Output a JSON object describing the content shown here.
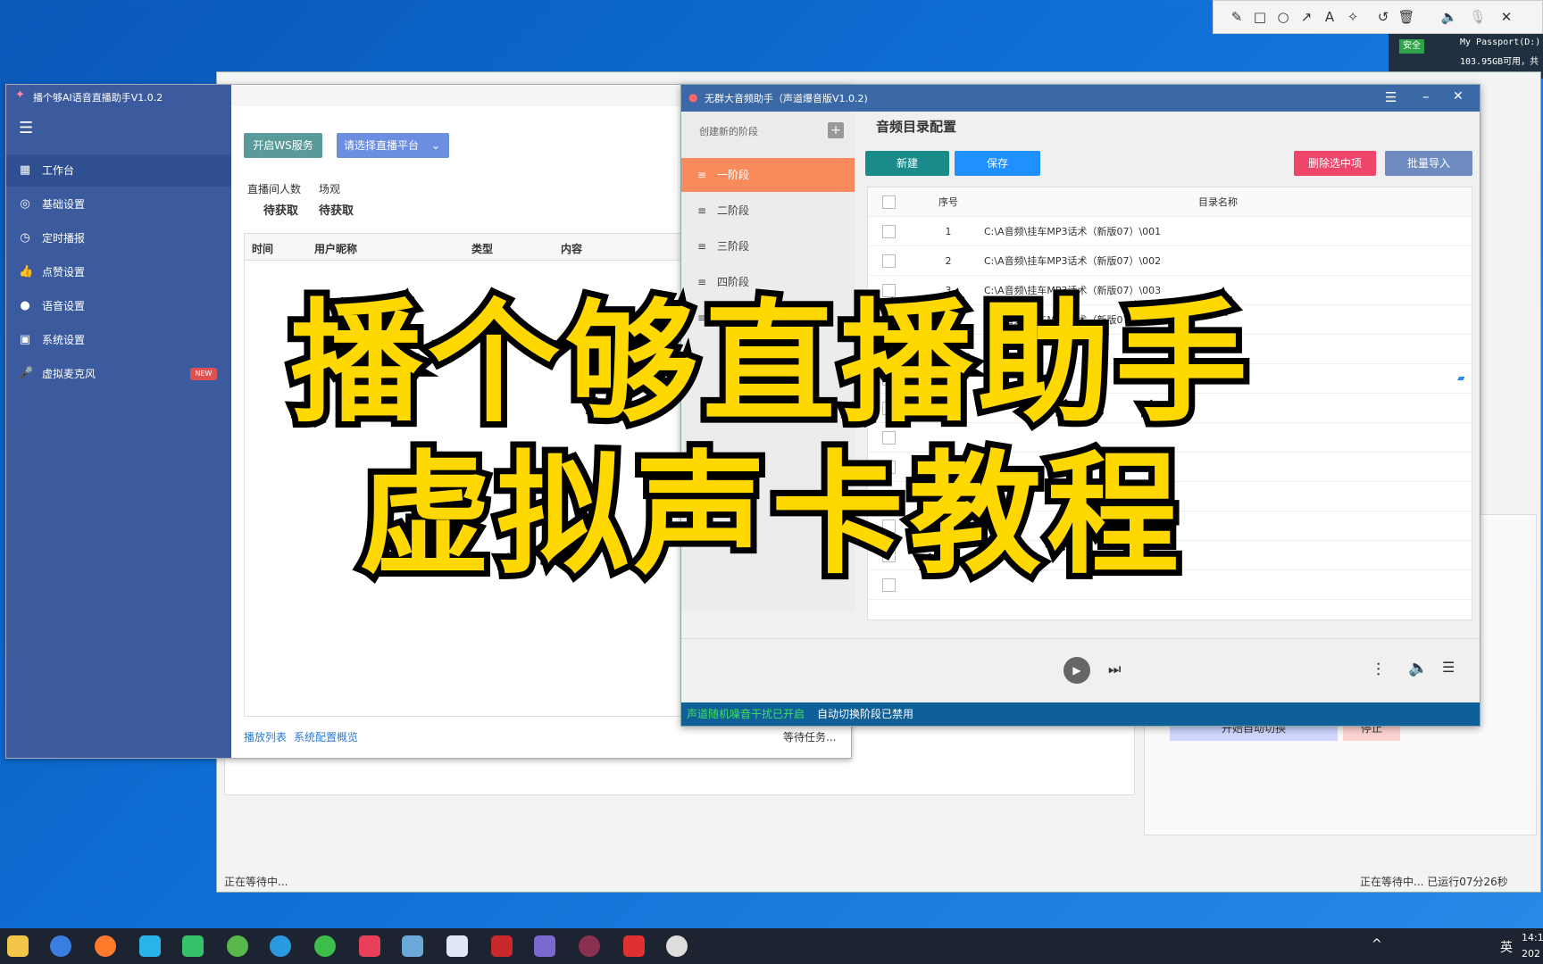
{
  "annotation_toolbar": {
    "icons": [
      "pencil-icon",
      "rectangle-icon",
      "circle-icon",
      "arrow-icon",
      "text-icon",
      "magic-icon",
      "undo-icon",
      "trash-icon",
      "volume-icon",
      "mute-icon",
      "close-icon"
    ]
  },
  "drive": {
    "badge": "安全",
    "name": "My Passport(D:)",
    "free": "103.95GB可用，共"
  },
  "back_window": {
    "status_left": "正在等待中...",
    "status_right": "正在等待中...  已运行07分26秒",
    "start_switch": "开始自动切换",
    "stop": "停止"
  },
  "main_app": {
    "title": "播个够AI语音直播助手V1.0.2",
    "nav": [
      {
        "label": "工作台",
        "icon": "dashboard-icon"
      },
      {
        "label": "基础设置",
        "icon": "settings-circle-icon"
      },
      {
        "label": "定时播报",
        "icon": "timer-icon"
      },
      {
        "label": "点赞设置",
        "icon": "thumbs-up-icon"
      },
      {
        "label": "语音设置",
        "icon": "voice-icon"
      },
      {
        "label": "系统设置",
        "icon": "grid-icon"
      },
      {
        "label": "虚拟麦克风",
        "icon": "mic-icon",
        "badge": "NEW"
      }
    ],
    "ws_button": "开启WS服务",
    "platform_select": "请选择直播平台",
    "stats": {
      "viewers_label": "直播间人数",
      "viewers_value": "待获取",
      "scene_label": "场观",
      "scene_value": "待获取"
    },
    "columns": [
      "时间",
      "用户昵称",
      "类型",
      "内容"
    ],
    "footer_links": [
      "播放列表",
      "系统配置概览"
    ],
    "footer_status": "等待任务..."
  },
  "audio_window": {
    "title": "无群大音频助手（声道爆音版V1.0.2)",
    "create_stage": "创建新的阶段",
    "stages": [
      "一阶段",
      "二阶段",
      "三阶段",
      "四阶段",
      "五阶段"
    ],
    "heading": "音频目录配置",
    "buttons": {
      "new": "新建",
      "save": "保存",
      "delete": "删除选中项",
      "import": "批量导入"
    },
    "columns": {
      "seq": "序号",
      "name": "目录名称"
    },
    "rows": [
      {
        "seq": "1",
        "dir": "C:\\A音频\\挂车MP3话术（新版07）\\001"
      },
      {
        "seq": "2",
        "dir": "C:\\A音频\\挂车MP3话术（新版07）\\002"
      },
      {
        "seq": "3",
        "dir": "C:\\A音频\\挂车MP3话术（新版07）\\003"
      },
      {
        "seq": "4",
        "dir": "C:\\A音频\\挂车MP3话术（新版07）\\004"
      }
    ],
    "status_green": "声道随机噪音干扰已开启",
    "status_white": "自动切换阶段已禁用"
  },
  "overlay": {
    "line1": "播个够直播助手",
    "line2": "虚拟声卡教程"
  },
  "tray": {
    "lang": "英",
    "time": "14:1",
    "date": "202"
  },
  "colors": {
    "sidebar": "#3b5b9e",
    "stage_active": "#f98a5c",
    "btn_new": "#1a8a8a",
    "btn_save": "#1e90ff",
    "btn_delete": "#f0456a",
    "btn_import": "#6f8cc0",
    "overlay_text": "#ffd800"
  }
}
